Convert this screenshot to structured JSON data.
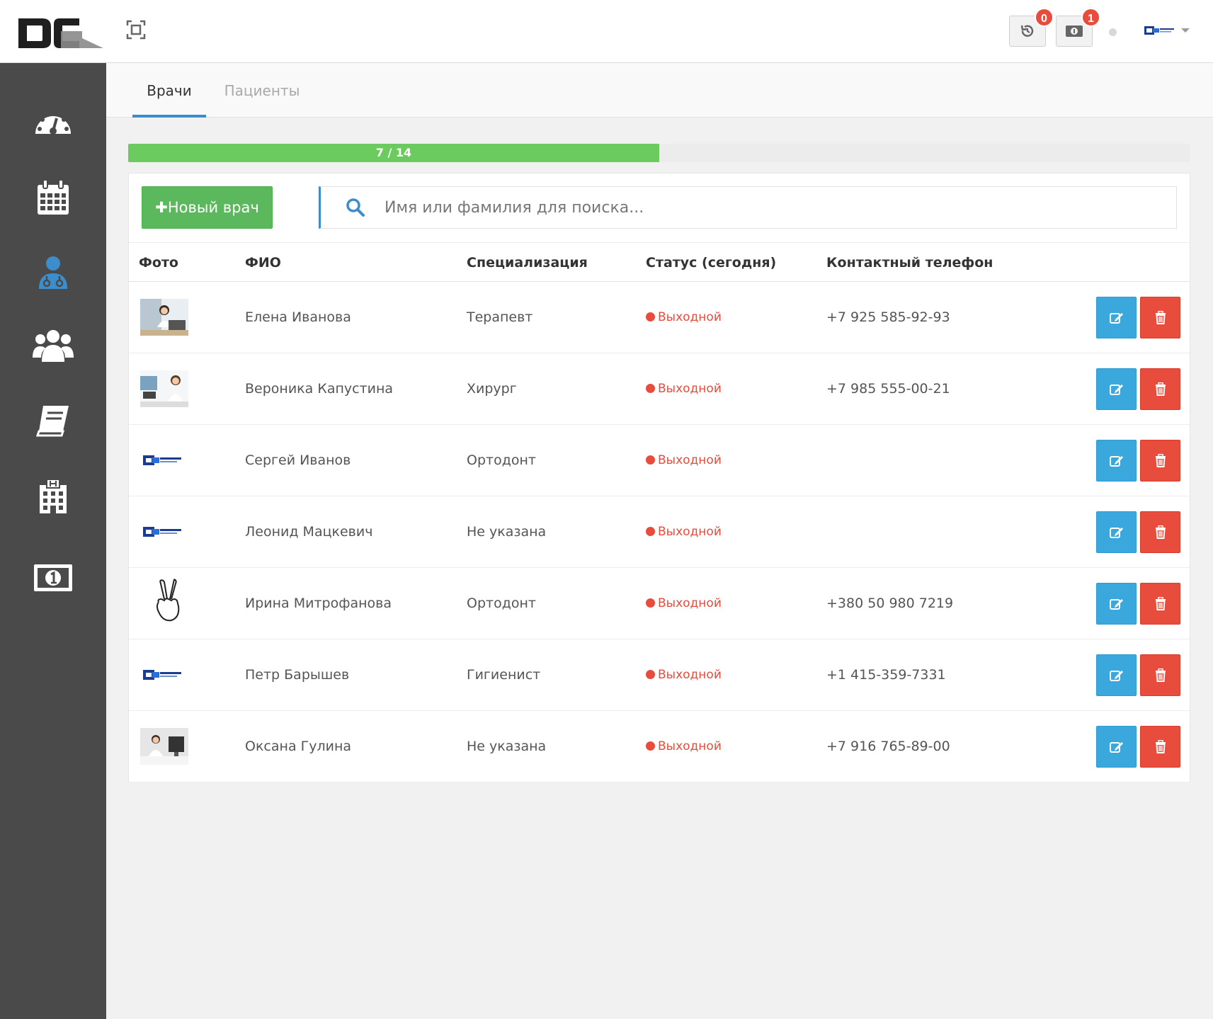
{
  "header": {
    "history_badge": "0",
    "billing_badge": "1"
  },
  "tabs": [
    {
      "label": "Врачи",
      "active": true
    },
    {
      "label": "Пациенты",
      "active": false
    }
  ],
  "progress": {
    "label": "7 / 14",
    "value": 7,
    "max": 14
  },
  "toolbar": {
    "new_button_label": "Новый врач",
    "search_placeholder": "Имя или фамилия для поиска..."
  },
  "table": {
    "headers": [
      "Фото",
      "ФИО",
      "Специализация",
      "Статус (сегодня)",
      "Контактный телефон"
    ],
    "rows": [
      {
        "name": "Елена Иванова",
        "spec": "Терапевт",
        "status": "Выходной",
        "phone": "+7 925 585-92-93",
        "photo": "woman-laptop-photo"
      },
      {
        "name": "Вероника Капустина",
        "spec": "Хирург",
        "status": "Выходной",
        "phone": "+7 985 555-00-21",
        "photo": "woman-office-photo"
      },
      {
        "name": "Сергей Иванов",
        "spec": "Ортодонт",
        "status": "Выходной",
        "phone": "",
        "photo": "dental-cloud-logo"
      },
      {
        "name": "Леонид Мацкевич",
        "spec": "Не указана",
        "status": "Выходной",
        "phone": "",
        "photo": "dental-cloud-logo"
      },
      {
        "name": "Ирина Митрофанова",
        "spec": "Ортодонт",
        "status": "Выходной",
        "phone": "+380 50 980 7219",
        "photo": "peace-hand-icon"
      },
      {
        "name": "Петр Барышев",
        "spec": "Гигиенист",
        "status": "Выходной",
        "phone": "+1 415-359-7331",
        "photo": "dental-cloud-logo"
      },
      {
        "name": "Оксана Гулина",
        "spec": "Не указана",
        "status": "Выходной",
        "phone": "+7 916 765-89-00",
        "photo": "woman-computer-photo"
      }
    ]
  },
  "sidebar": {
    "items": [
      {
        "icon": "dashboard-icon",
        "active": false
      },
      {
        "icon": "calendar-icon",
        "active": false
      },
      {
        "icon": "doctor-icon",
        "active": true
      },
      {
        "icon": "users-icon",
        "active": false
      },
      {
        "icon": "book-icon",
        "active": false
      },
      {
        "icon": "hospital-icon",
        "active": false
      },
      {
        "icon": "money-icon",
        "active": false
      }
    ]
  },
  "colors": {
    "sidebar_bg": "#4a4a4a",
    "accent_blue": "#3c8dcb",
    "progress_green": "#6ccb5f",
    "new_button_green": "#5cb85c",
    "edit_blue": "#3aa8dc",
    "delete_red": "#e74c3c",
    "status_red": "#e74c3c"
  }
}
